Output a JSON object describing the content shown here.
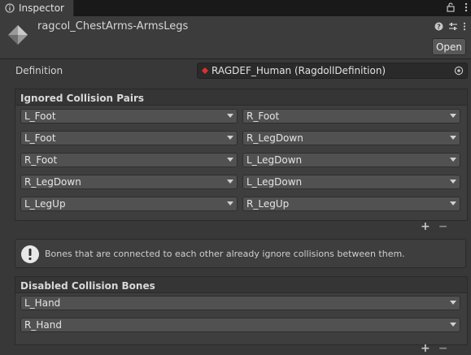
{
  "tab": {
    "title": "Inspector",
    "lock_icon": "lock-icon",
    "menu_icon": "kebab-menu-icon"
  },
  "header": {
    "object_name": "ragcol_ChestArms-ArmsLegs",
    "object_icon": "ragdoll-collision-asset-icon",
    "help_icon": "help-icon",
    "preset_icon": "preset-sliders-icon",
    "more_icon": "kebab-menu-icon",
    "open_label": "Open"
  },
  "definition": {
    "label": "Definition",
    "value": "RAGDEF_Human (RagdollDefinition)",
    "accent": "#e0322b"
  },
  "ignored_pairs": {
    "title": "Ignored Collision Pairs",
    "pairs": [
      [
        "L_Foot",
        "R_Foot"
      ],
      [
        "L_Foot",
        "R_LegDown"
      ],
      [
        "R_Foot",
        "L_LegDown"
      ],
      [
        "R_LegDown",
        "L_LegDown"
      ],
      [
        "L_LegUp",
        "R_LegUp"
      ]
    ],
    "add_label": "+",
    "remove_label": "−"
  },
  "info": {
    "text": "Bones that are connected to each other already ignore collisions between them.",
    "icon": "info-exclamation-icon"
  },
  "disabled_bones": {
    "title": "Disabled Collision Bones",
    "bones": [
      "L_Hand",
      "R_Hand"
    ],
    "add_label": "+",
    "remove_label": "−"
  }
}
